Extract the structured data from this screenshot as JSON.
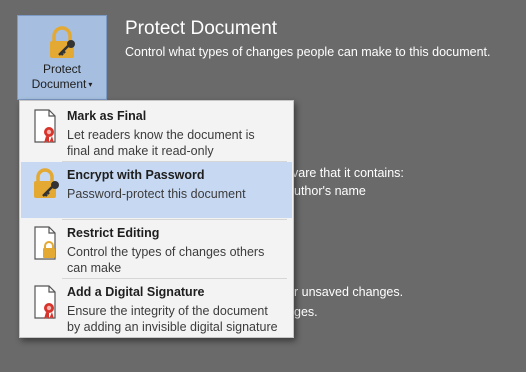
{
  "protect_button": {
    "line1": "Protect",
    "line2": "Document",
    "caret": "▾"
  },
  "section": {
    "title": "Protect Document",
    "description": "Control what types of changes people can make to this document."
  },
  "background_fragments": {
    "line1": "vare that it contains:",
    "line2": "uthor's name",
    "line3": "r unsaved changes.",
    "line4": "ges."
  },
  "menu": {
    "items": [
      {
        "title": "Mark as Final",
        "desc": "Let readers know the document is\nfinal and make it read-only",
        "icon": "doc-ribbon-icon",
        "highlighted": false
      },
      {
        "title": "Encrypt with Password",
        "desc": "Password-protect this document",
        "icon": "lock-key-icon",
        "highlighted": true
      },
      {
        "title": "Restrict Editing",
        "desc": "Control the types of changes others\ncan make",
        "icon": "doc-lock-icon",
        "highlighted": false
      },
      {
        "title": "Add a Digital Signature",
        "desc": "Ensure the integrity of the document\nby adding an invisible digital signature",
        "icon": "doc-signature-icon",
        "highlighted": false
      }
    ]
  },
  "colors": {
    "background": "#6a6a6a",
    "highlight": "#c6d8f2",
    "button": "#a6bfe0",
    "lock": "#e3a933"
  }
}
